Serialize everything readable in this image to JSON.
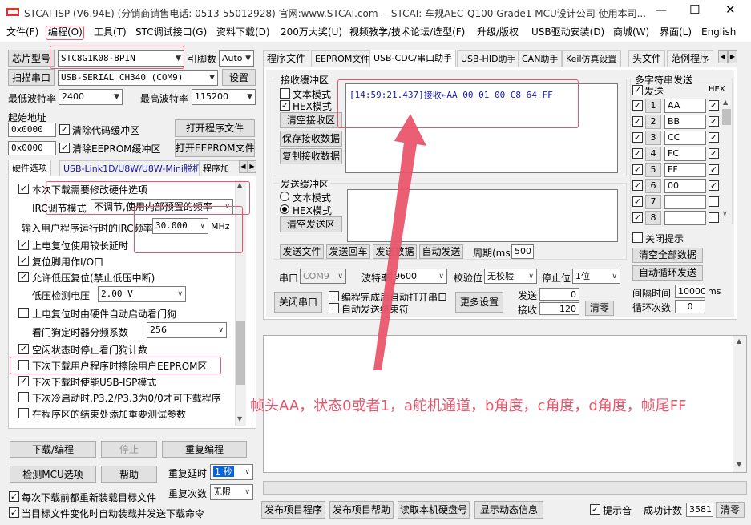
{
  "window": {
    "title": "STCAI-ISP (V6.94E) (分销商销售电话: 0513-55012928) 官网:www.STCAI.com  -- STCAI: 车规AEC-Q100 Grade1 MCU设计公司 使用本司..."
  },
  "menu": [
    "文件(F)",
    "编程(O)",
    "工具(T)",
    "STC调试接口(G)",
    "资料下载(D)",
    "200万大奖(U)",
    "视频教学/技术论坛/选型(F)",
    "升级/版权",
    "USB驱动安装(D)",
    "商城(W)",
    "界面(L)",
    "English"
  ],
  "left": {
    "chip_label": "芯片型号",
    "chip_value": "STC8G1K08-8PIN",
    "pin_label": "引脚数",
    "pin_value": "Auto",
    "scan_label": "扫描串口",
    "port_value": "USB-SERIAL CH340 (COM9)",
    "settings_label": "设置",
    "min_baud_label": "最低波特率",
    "min_baud": "2400",
    "max_baud_label": "最高波特率",
    "max_baud": "115200",
    "start_addr_label": "起始地址",
    "addr1": "0x0000",
    "clear_code": "清除代码缓冲区",
    "open_prog": "打开程序文件",
    "addr2": "0x0000",
    "clear_eeprom": "清除EEPROM缓冲区",
    "open_eeprom": "打开EEPROM文件",
    "tabs": [
      "硬件选项",
      "USB-Link1D/U8W/U8W-Mini脱机",
      "程序加"
    ],
    "opts": {
      "o1": "本次下载需要修改硬件选项",
      "irc_label": "IRC调节模式",
      "irc_value": "不调节,使用内部预置的频率",
      "freq_label": "输入用户程序运行时的IRC频率",
      "freq_value": "30.000",
      "mhz": "MHz",
      "o2": "上电复位使用较长延时",
      "o3": "复位脚用作I/O口",
      "o4": "允许低压复位(禁止低压中断)",
      "lv_label": "低压检测电压",
      "lv_value": "2.00 V",
      "o5": "上电复位时由硬件自动启动看门狗",
      "wd_label": "看门狗定时器分频系数",
      "wd_value": "256",
      "o6": "空闲状态时停止看门狗计数",
      "o7": "下次下载用户程序时擦除用户EEPROM区",
      "o8": "下次下载时使能USB-ISP模式",
      "o9": "下次冷启动时,P3.2/P3.3为0/0才可下载程序",
      "o10": "在程序区的结束处添加重要测试参数"
    },
    "download": "下载/编程",
    "stop": "停止",
    "reprogram": "重复编程",
    "check_mcu": "检测MCU选项",
    "help": "帮助",
    "repeat_delay_label": "重复延时",
    "repeat_delay": "1 秒",
    "repeat_count_label": "重复次数",
    "repeat_count": "无限",
    "reload": "每次下载前都重新装载目标文件",
    "auto_send": "当目标文件变化时自动装载并发送下载命令"
  },
  "right": {
    "tabs": [
      "程序文件",
      "EEPROM文件",
      "USB-CDC/串口助手",
      "USB-HID助手",
      "CAN助手",
      "Keil仿真设置",
      "头文件",
      "范例程序"
    ],
    "recv": {
      "title": "接收缓冲区",
      "text_mode": "文本模式",
      "hex_mode": "HEX模式",
      "clear": "清空接收区",
      "save": "保存接收数据",
      "copy": "复制接收数据",
      "content": "[14:59:21.437]接收←AA 00 01 00 C8 64 FF"
    },
    "send": {
      "title": "发送缓冲区",
      "text_mode": "文本模式",
      "hex_mode": "HEX模式",
      "clear": "清空发送区"
    },
    "send_btns": [
      "发送文件",
      "发送回车",
      "发送数据",
      "自动发送"
    ],
    "period_label": "周期(ms)",
    "period": "500",
    "multi": {
      "title": "多字符串发送",
      "send_hdr": "发送",
      "hex_hdr": "HEX",
      "rows": [
        {
          "n": "1",
          "v": "AA"
        },
        {
          "n": "2",
          "v": "BB"
        },
        {
          "n": "3",
          "v": "CC"
        },
        {
          "n": "4",
          "v": "FC"
        },
        {
          "n": "5",
          "v": "FF"
        },
        {
          "n": "6",
          "v": "00"
        },
        {
          "n": "7",
          "v": ""
        },
        {
          "n": "8",
          "v": ""
        }
      ],
      "close_tip": "关闭提示",
      "clear_all": "清空全部数据",
      "auto_loop": "自动循环发送",
      "interval_label": "间隔时间",
      "interval": "10000",
      "ms": "ms",
      "loop_label": "循环次数",
      "loop": "0"
    },
    "port_label": "串口",
    "port": "COM9",
    "baud_label": "波特率",
    "baud": "9600",
    "parity_label": "校验位",
    "parity": "无校验",
    "stop_label": "停止位",
    "stopbits": "1位",
    "close_port": "关闭串口",
    "cb_open": "编程完成后自动打开串口",
    "cb_auto": "自动发送结束符",
    "more": "更多设置",
    "sent_label": "发送",
    "sent": "0",
    "recv_label": "接收",
    "recv_count": "120",
    "clear_count": "清零",
    "annotation": "帧头AA，状态0或者1，a舵机通道，b角度，c角度，d角度，帧尾FF"
  },
  "bottom": {
    "publish_prog": "发布项目程序",
    "publish_help": "发布项目帮助",
    "read_disk": "读取本机硬盘号",
    "show_dyn": "显示动态信息",
    "beep": "提示音",
    "success_label": "成功计数",
    "success": "3581",
    "clear": "清零"
  },
  "colors": {
    "annotation": "#e9566c",
    "hex_text": "#1a1aa8",
    "tab_active": "#ffffff"
  }
}
